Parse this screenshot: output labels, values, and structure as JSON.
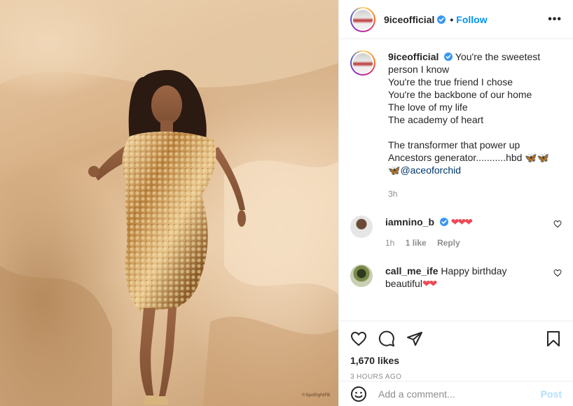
{
  "post": {
    "username": "9iceofficial",
    "follow_label": "Follow",
    "dot": "•",
    "more_label": "•••",
    "watermark": "©SpotlightFB"
  },
  "caption": {
    "username": "9iceofficial",
    "lines": [
      "You're the sweetest",
      "person I know",
      "You're the true friend I chose",
      "You're the backbone of our home",
      "The love of my life",
      "The academy of heart",
      "The transformer that power up",
      "Ancestors generator...........hbd",
      "@aceoforchid"
    ],
    "butterflies_1": "🦋🦋",
    "butterflies_2": "🦋",
    "time": "3h"
  },
  "comments": [
    {
      "username": "iamnino_b",
      "text": "❤❤❤",
      "time": "1h",
      "likes": "1 like",
      "reply": "Reply"
    },
    {
      "username": "call_me_ife",
      "text": "Happy birthday beautiful",
      "hearts": "❤❤",
      "time": "",
      "likes": "",
      "reply": ""
    }
  ],
  "stats": {
    "likes": "1,670 likes",
    "ago": "3 HOURS AGO"
  },
  "composer": {
    "placeholder": "Add a comment...",
    "post_label": "Post"
  },
  "colors": {
    "follow": "#0095f6",
    "verified": "#3897f0",
    "heart": "#ed4956",
    "post_disabled": "#b2dffc"
  },
  "icons": [
    "verified-badge-icon",
    "heart-icon",
    "comment-icon",
    "share-icon",
    "bookmark-icon",
    "emoji-icon",
    "more-icon"
  ]
}
